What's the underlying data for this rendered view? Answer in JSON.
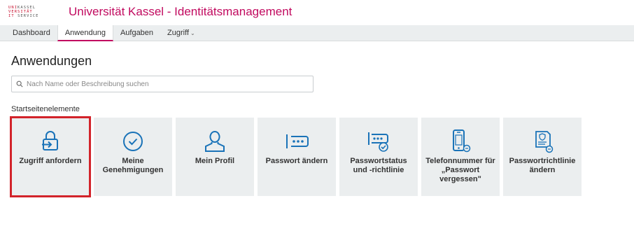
{
  "logo": {
    "line1_accent": "UNI",
    "line1_rest": "KASSEL",
    "line2_accent": "VERSITÄT",
    "line3_accent": "IT",
    "line3_rest": "SERVICE"
  },
  "header": {
    "title": "Universität Kassel - Identitätsmanagement"
  },
  "nav": {
    "tabs": [
      {
        "label": "Dashboard"
      },
      {
        "label": "Anwendung"
      },
      {
        "label": "Aufgaben"
      },
      {
        "label": "Zugriff"
      }
    ],
    "active_index": 1
  },
  "main": {
    "title": "Anwendungen",
    "search": {
      "placeholder": "Nach Name oder Beschreibung suchen",
      "value": ""
    },
    "section_label": "Startseitenelemente",
    "tiles": [
      {
        "label": "Zugriff anfordern",
        "icon": "lock-arrow-icon",
        "selected": true
      },
      {
        "label": "Meine\nGenehmigungen",
        "icon": "check-circle-icon",
        "selected": false
      },
      {
        "label": "Mein Profil",
        "icon": "user-profile-icon",
        "selected": false
      },
      {
        "label": "Passwort ändern",
        "icon": "password-dots-icon",
        "selected": false
      },
      {
        "label": "Passwortstatus\nund -richtlinie",
        "icon": "password-status-icon",
        "selected": false
      },
      {
        "label": "Telefonnummer für\n„Passwort\nvergessen\"",
        "icon": "phone-icon",
        "selected": false
      },
      {
        "label": "Passwortrichtlinie\nändern",
        "icon": "policy-document-icon",
        "selected": false
      }
    ]
  },
  "colors": {
    "brand": "#c10a5f",
    "icon_blue": "#1a73b8",
    "tile_bg": "#ebeeef",
    "selection_red": "#d2232a"
  }
}
